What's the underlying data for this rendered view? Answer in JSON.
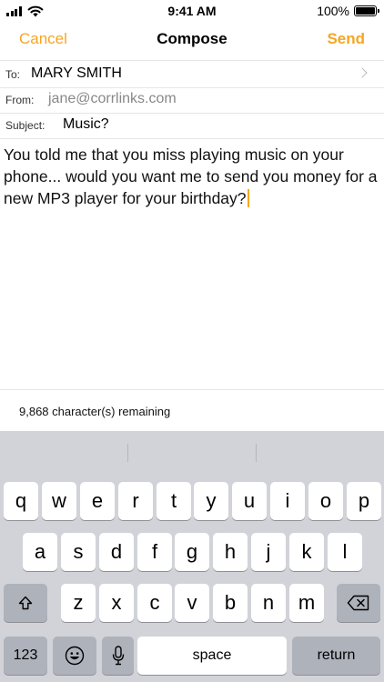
{
  "status_bar": {
    "time": "9:41 AM",
    "battery_percent_label": "100%",
    "battery_level": 1.0,
    "signal_bars": 4,
    "icons": [
      "signal-icon",
      "wifi-icon",
      "battery-icon"
    ]
  },
  "nav": {
    "cancel_label": "Cancel",
    "title": "Compose",
    "send_label": "Send",
    "accent_color": "#f5a623"
  },
  "header": {
    "to_label": "To:",
    "to_value": "MARY SMITH",
    "from_label": "From:",
    "from_value": "jane@corrlinks.com",
    "subject_label": "Subject:",
    "subject_value": "Music?"
  },
  "body": {
    "text": "You told me that you miss playing music on your phone... would you want me to send you money for a new MP3 player for your birthday?"
  },
  "counter": {
    "text": "9,868 character(s) remaining"
  },
  "keyboard": {
    "row1": [
      "q",
      "w",
      "e",
      "r",
      "t",
      "y",
      "u",
      "i",
      "o",
      "p"
    ],
    "row2": [
      "a",
      "s",
      "d",
      "f",
      "g",
      "h",
      "j",
      "k",
      "l"
    ],
    "row3": [
      "z",
      "x",
      "c",
      "v",
      "b",
      "n",
      "m"
    ],
    "numbers_label": "123",
    "space_label": "space",
    "return_label": "return",
    "icons": [
      "shift-icon",
      "delete-icon",
      "emoji-icon",
      "microphone-icon"
    ]
  }
}
